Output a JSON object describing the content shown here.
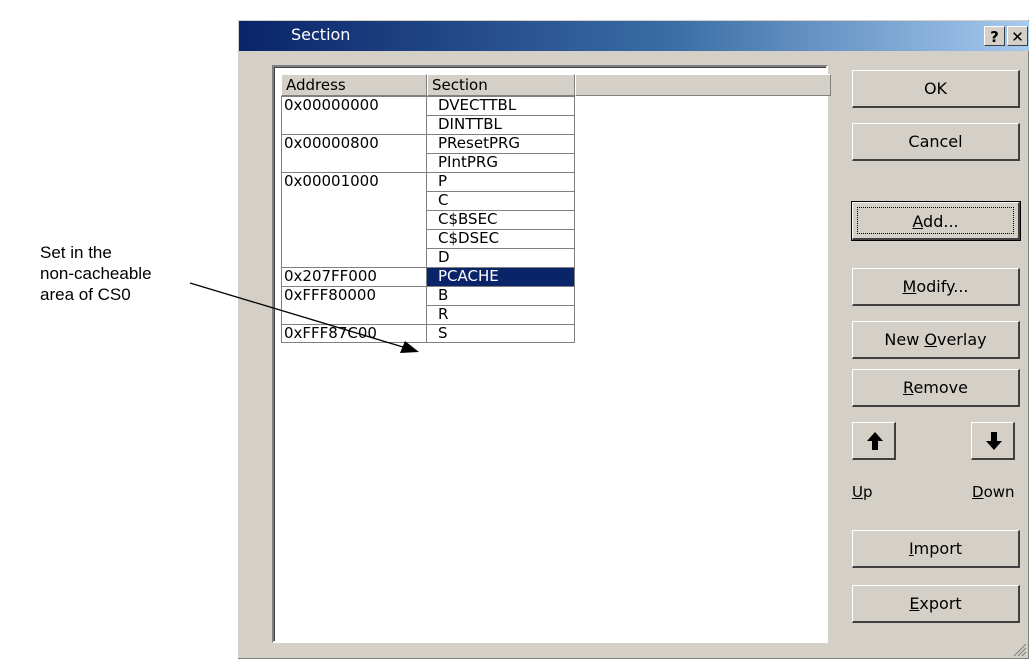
{
  "annotation": {
    "lines": [
      "Set in the",
      "non-cacheable",
      "area of CS0"
    ]
  },
  "dialog": {
    "title": "Section",
    "help_button": "?",
    "close_button": "✕"
  },
  "table": {
    "columns": [
      "Address",
      "Section",
      ""
    ],
    "rows": [
      {
        "address": "0x00000000",
        "section": "DVECTTBL"
      },
      {
        "address": "",
        "section": "DINTTBL"
      },
      {
        "address": "0x00000800",
        "section": "PResetPRG"
      },
      {
        "address": "",
        "section": "PIntPRG"
      },
      {
        "address": "0x00001000",
        "section": "P"
      },
      {
        "address": "",
        "section": "C"
      },
      {
        "address": "",
        "section": "C$BSEC"
      },
      {
        "address": "",
        "section": "C$DSEC"
      },
      {
        "address": "",
        "section": "D"
      },
      {
        "address": "0x207FF000",
        "section": "PCACHE",
        "selected": true
      },
      {
        "address": "0xFFF80000",
        "section": "B"
      },
      {
        "address": "",
        "section": "R"
      },
      {
        "address": "0xFFF87C00",
        "section": "S"
      }
    ]
  },
  "buttons": {
    "ok": "OK",
    "cancel": "Cancel",
    "add": {
      "pre": "",
      "mn": "A",
      "post": "dd..."
    },
    "modify": {
      "pre": "",
      "mn": "M",
      "post": "odify..."
    },
    "new_overlay": {
      "pre": "New ",
      "mn": "O",
      "post": "verlay"
    },
    "remove": {
      "pre": "",
      "mn": "R",
      "post": "emove"
    },
    "up": {
      "pre": "",
      "mn": "U",
      "post": "p"
    },
    "down": {
      "pre": "",
      "mn": "D",
      "post": "own"
    },
    "import": {
      "pre": "",
      "mn": "I",
      "post": "mport"
    },
    "export": {
      "pre": "",
      "mn": "E",
      "post": "xport"
    }
  },
  "colors": {
    "selection": "#0a246a",
    "face": "#d4d0c8",
    "title_start": "#0a246a",
    "title_end": "#a6caf0"
  }
}
